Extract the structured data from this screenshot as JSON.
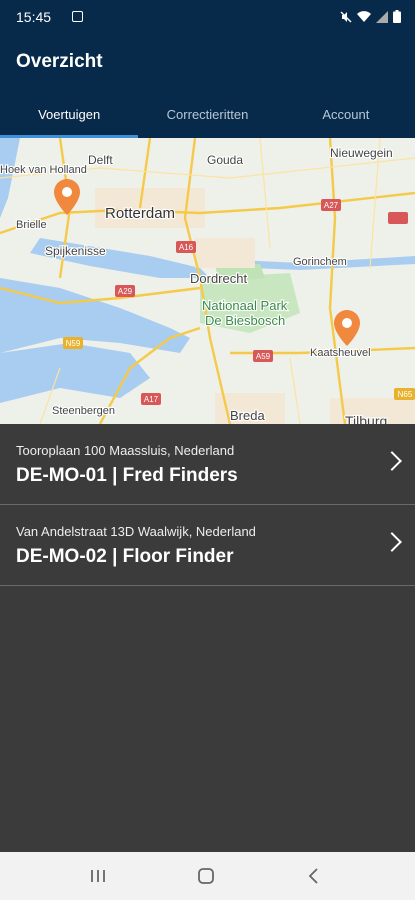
{
  "status": {
    "time": "15:45"
  },
  "appbar": {
    "title": "Overzicht"
  },
  "tabs": [
    {
      "label": "Voertuigen",
      "active": true
    },
    {
      "label": "Correctieritten",
      "active": false
    },
    {
      "label": "Account",
      "active": false
    }
  ],
  "map": {
    "labels": {
      "hoek_van_holland": "Hoek van Holland",
      "delft": "Delft",
      "gouda": "Gouda",
      "nieuwegein": "Nieuwegein",
      "brielle": "Brielle",
      "rotterdam": "Rotterdam",
      "spijkenisse": "Spijkenisse",
      "dordrecht": "Dordrecht",
      "gorinchem": "Gorinchem",
      "np1": "Nationaal Park",
      "np2": "De Biesbosch",
      "kaatsheuvel": "Kaatsheuvel",
      "steenbergen": "Steenbergen",
      "breda": "Breda",
      "tilburg": "Tilburg"
    },
    "roads": [
      "A27",
      "A16",
      "A29",
      "N59",
      "A59",
      "A17",
      "N65"
    ]
  },
  "vehicles": [
    {
      "address": "Tooroplaan 100 Maassluis, Nederland",
      "name": "DE-MO-01 | Fred Finders"
    },
    {
      "address": "Van Andelstraat 13D Waalwijk, Nederland",
      "name": "DE-MO-02 | Floor Finder"
    }
  ],
  "colors": {
    "header": "#07294a",
    "tab_indicator": "#3d8fd6",
    "list_bg": "#3b3b3b",
    "marker": "#f0883e"
  }
}
